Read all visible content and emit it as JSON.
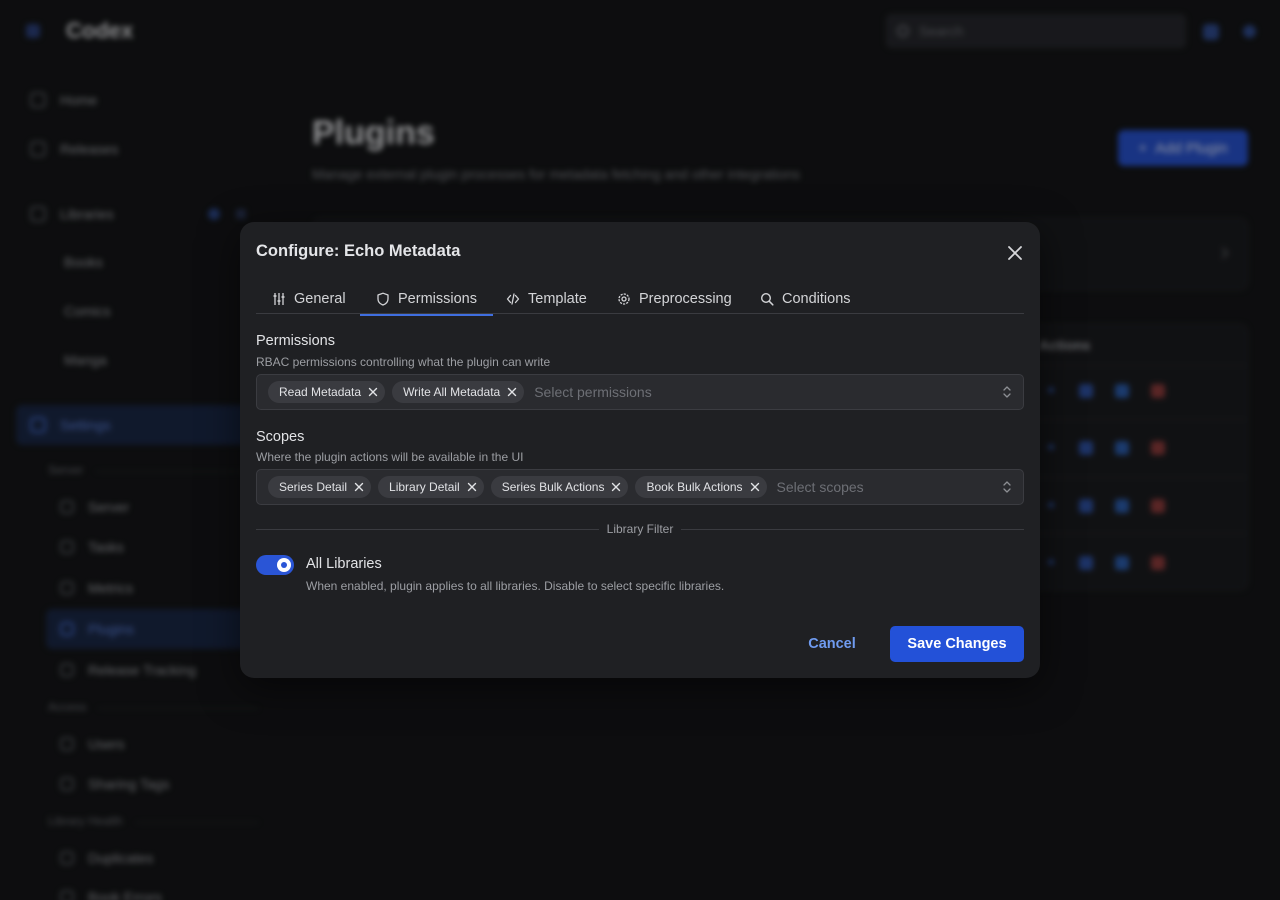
{
  "app": {
    "brand": "Codex",
    "search_placeholder": "Search"
  },
  "sidebar": {
    "home": "Home",
    "releases": "Releases",
    "libraries": "Libraries",
    "lib_books": "Books",
    "lib_comics": "Comics",
    "lib_manga": "Manga",
    "settings": "Settings",
    "section_server": "Server",
    "server": "Server",
    "tasks": "Tasks",
    "metrics": "Metrics",
    "plugins": "Plugins",
    "release_tracking": "Release Tracking",
    "section_access": "Access",
    "users": "Users",
    "sharing_tags": "Sharing Tags",
    "section_library_health": "Library Health",
    "duplicates": "Duplicates",
    "book_errors": "Book Errors"
  },
  "main": {
    "title": "Plugins",
    "subtitle": "Manage external plugin processes for metadata fetching and other integrations",
    "add_button": "Add Plugin",
    "actions_header": "Actions"
  },
  "modal": {
    "title": "Configure: Echo Metadata",
    "tabs": [
      {
        "label": "General",
        "icon": "sliders-icon",
        "active": false
      },
      {
        "label": "Permissions",
        "icon": "shield-icon",
        "active": true
      },
      {
        "label": "Template",
        "icon": "code-icon",
        "active": false
      },
      {
        "label": "Preprocessing",
        "icon": "gear-icon",
        "active": false
      },
      {
        "label": "Conditions",
        "icon": "search-icon",
        "active": false
      }
    ],
    "permissions": {
      "label": "Permissions",
      "description": "RBAC permissions controlling what the plugin can write",
      "selected": [
        "Read Metadata",
        "Write All Metadata"
      ],
      "placeholder": "Select permissions"
    },
    "scopes": {
      "label": "Scopes",
      "description": "Where the plugin actions will be available in the UI",
      "selected": [
        "Series Detail",
        "Library Detail",
        "Series Bulk Actions",
        "Book Bulk Actions"
      ],
      "placeholder": "Select scopes"
    },
    "library_filter": {
      "divider_label": "Library Filter",
      "toggle_label": "All Libraries",
      "toggle_description": "When enabled, plugin applies to all libraries. Disable to select specific libraries.",
      "enabled": true
    },
    "cancel_label": "Cancel",
    "save_label": "Save Changes"
  },
  "colors": {
    "accent": "#2351d8",
    "tab_underline": "#3f6ee0",
    "link": "#6f9bf0",
    "modal_bg": "#1f2023",
    "page_bg": "#141517"
  }
}
